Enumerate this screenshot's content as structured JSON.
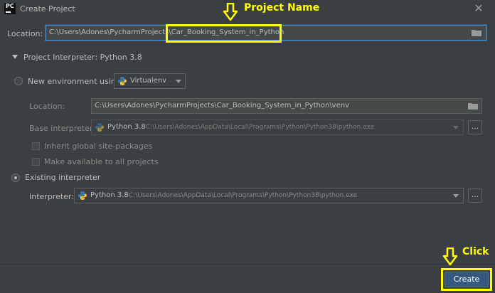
{
  "window": {
    "title": "Create Project",
    "app_icon_label": "PC"
  },
  "location": {
    "label": "Location:",
    "value_prefix": "C:\\Users\\Adones\\PycharmProjects\\",
    "value_name": "Car_Booking_System_in_Python"
  },
  "interpreter_section": {
    "title": "Project Interpreter: Python 3.8"
  },
  "new_env": {
    "radio_label": "New environment using",
    "tool": "Virtualenv",
    "location_label": "Location:",
    "location_value": "C:\\Users\\Adones\\PycharmProjects\\Car_Booking_System_in_Python\\venv",
    "base_label": "Base interpreter:",
    "base_version": "Python 3.8",
    "base_path": "C:\\Users\\Adones\\AppData\\Local\\Programs\\Python\\Python38\\python.exe",
    "inherit_label": "Inherit global site-packages",
    "available_label": "Make available to all projects"
  },
  "existing": {
    "radio_label": "Existing interpreter",
    "interpreter_label": "Interpreter:",
    "version": "Python 3.8",
    "path": "C:\\Users\\Adones\\AppData\\Local\\Programs\\Python\\Python38\\python.exe"
  },
  "buttons": {
    "browse": "...",
    "create": "Create"
  },
  "annotations": {
    "project_name": "Project Name",
    "click": "Click"
  },
  "colors": {
    "background": "#3c3f41",
    "annotation": "#ffff00",
    "accent": "#365880"
  }
}
